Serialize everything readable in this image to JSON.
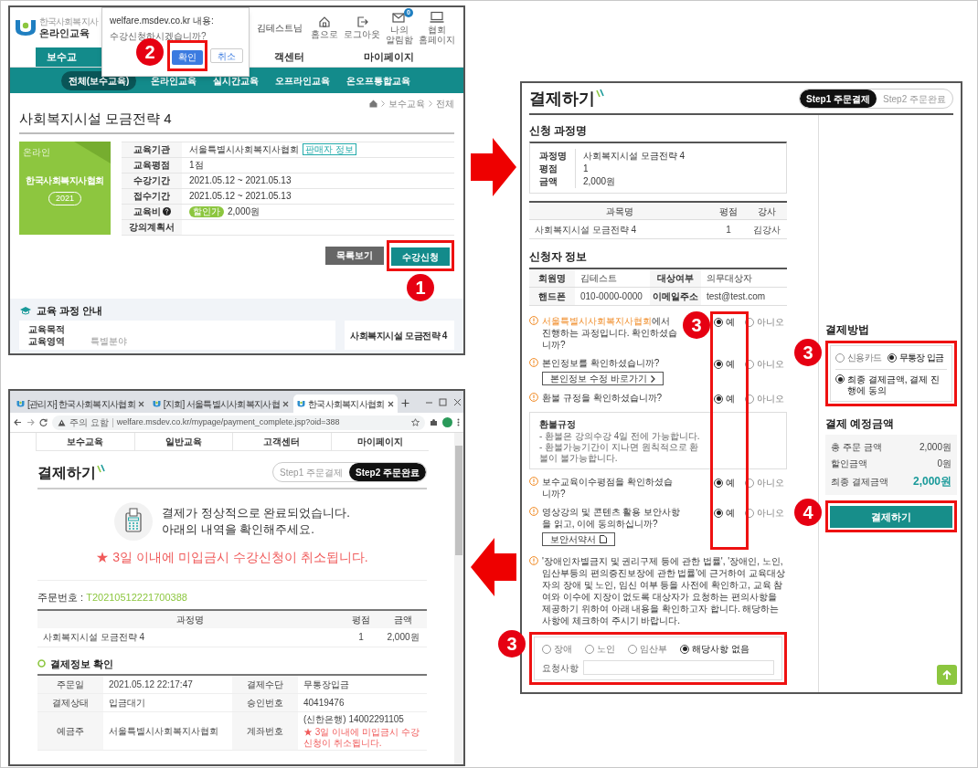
{
  "course_page": {
    "logo": {
      "subtitle": "한국사회복지사",
      "title": "온라인교육"
    },
    "user_name": "김테스트님",
    "header_links": [
      {
        "label": "홈으로",
        "kind": "home"
      },
      {
        "label": "로그아웃",
        "kind": "logout"
      },
      {
        "label": "나의 알림함",
        "kind": "alerts",
        "badge": "0"
      },
      {
        "label": "협회 홈페이지",
        "kind": "site"
      }
    ],
    "main_nav": [
      {
        "label": "보수교",
        "selected": true
      },
      {
        "label": "객센터",
        "selected": false
      },
      {
        "label": "마이페이지",
        "selected": false
      }
    ],
    "dialog": {
      "title": "welfare.msdev.co.kr 내용:",
      "message": "수강신청하시겠습니까?",
      "buttons": [
        {
          "label": "확인",
          "kind": "primary"
        },
        {
          "label": "취소",
          "kind": "secondary"
        }
      ]
    },
    "sub_nav": [
      {
        "label": "전체(보수교육)",
        "selected": true
      },
      {
        "label": "온라인교육",
        "selected": false
      },
      {
        "label": "실시간교육",
        "selected": false
      },
      {
        "label": "오프라인교육",
        "selected": false
      },
      {
        "label": "온오프통합교육",
        "selected": false
      }
    ],
    "breadcrumb": [
      "보수교육",
      "전체"
    ],
    "title": "사회복지시설 모금전략 4",
    "thumbnail": {
      "tag": "온라인",
      "title": "한국사회복지사협회",
      "year": "2021"
    },
    "info_rows": [
      {
        "label": "교육기관",
        "value": "서울특별시사회복지사협회",
        "kind": "seller",
        "badge": "판매자 정보"
      },
      {
        "label": "교육평점",
        "value": "1점",
        "kind": "plain"
      },
      {
        "label": "수강기간",
        "value": "2021.05.12 ~ 2021.05.13",
        "kind": "plain"
      },
      {
        "label": "접수기간",
        "value": "2021.05.12 ~ 2021.05.13",
        "kind": "plain"
      },
      {
        "label": "교육비",
        "value": "2,000원",
        "kind": "fee",
        "badge": "할인가"
      },
      {
        "label": "강의계획서",
        "kind": "plain"
      }
    ],
    "buttons": [
      {
        "label": "목록보기",
        "kind": "secondary"
      },
      {
        "label": "수강신청",
        "kind": "primary"
      }
    ],
    "guide": {
      "title": "교육 과정 안내",
      "rows": [
        {
          "label": "교육목적"
        },
        {
          "label": "교육영역",
          "value": "특별분야"
        }
      ],
      "side_title": "사회복지시설 모금전략 4"
    }
  },
  "payment_page": {
    "title": "결제하기",
    "steps": [
      {
        "label": "Step1 주문결제",
        "selected": true
      },
      {
        "label": "Step2 주문완료",
        "selected": false
      }
    ],
    "course_section": {
      "title": "신청 과정명",
      "summary": [
        {
          "label": "과정명",
          "value": "사회복지시설 모금전략 4"
        },
        {
          "label": "평점",
          "value": "1"
        },
        {
          "label": "금액",
          "value": "2,000원"
        }
      ],
      "columns": [
        "과목명",
        "평점",
        "강사"
      ],
      "rows": [
        [
          "사회복지시설 모금전략 4",
          "1",
          "김강사"
        ]
      ]
    },
    "applicant": {
      "title": "신청자 정보",
      "rows": [
        [
          "회원명",
          "김테스트",
          "대상여부",
          "의무대상자"
        ],
        [
          "핸드폰",
          "010-0000-0000",
          "이메일주소",
          "test@test.com"
        ]
      ]
    },
    "questions": [
      {
        "highlight": "서울특별시사회복지사협회",
        "text": "에서 진행하는 과정입니다. 확인하셨습니까?",
        "options": [
          {
            "label": "예",
            "selected": true
          },
          {
            "label": "아니오",
            "selected": false
          }
        ]
      },
      {
        "text": "본인정보를 확인하셨습니까?",
        "button": "본인정보 수정 바로가기",
        "options": [
          {
            "label": "예",
            "selected": true
          },
          {
            "label": "아니오",
            "selected": false
          }
        ]
      },
      {
        "text": "환불 규정을 확인하셨습니까?",
        "refund": {
          "title": "환불규정",
          "lines": [
            "- 환불은 강의수강 4일 전에 가능합니다.",
            "- 환불가능기간이 지나면 원칙적으로 환불이 불가능합니다."
          ]
        },
        "options": [
          {
            "label": "예",
            "selected": true
          },
          {
            "label": "아니오",
            "selected": false
          }
        ]
      },
      {
        "text": "보수교육이수평점을 확인하셨습니까?",
        "options": [
          {
            "label": "예",
            "selected": true
          },
          {
            "label": "아니오",
            "selected": false
          }
        ]
      },
      {
        "text": "영상강의 및 콘텐츠 활용 보안사항을 읽고, 이에 동의하십니까?",
        "button": "보안서약서",
        "options": [
          {
            "label": "예",
            "selected": true
          },
          {
            "label": "아니오",
            "selected": false
          }
        ]
      }
    ],
    "notice": "'장애인차별금지 및 권리구제 등에 관한 법률', '장애인, 노인, 임산부등의 편의증진보장에 관한 법률'에 근거하여 교육대상자의 장애 및 노인, 임신 여부 등을 사전에 확인하고, 교육 참여와 이수에 지장이 없도록 대상자가 요청하는 편의사항을 제공하기 위하여 아래 내용을 확인하고자 합니다. 해당하는 사항에 체크하여 주시기 바랍니다.",
    "accommodations": [
      {
        "label": "장애",
        "selected": false
      },
      {
        "label": "노인",
        "selected": false
      },
      {
        "label": "임산부",
        "selected": false
      },
      {
        "label": "해당사항 없음",
        "selected": true
      }
    ],
    "request_label": "요청사항",
    "payment_method": {
      "title": "결제방법",
      "options": [
        {
          "label": "신용카드",
          "selected": false
        },
        {
          "label": "무통장 입금",
          "selected": true
        }
      ],
      "agree": {
        "label": "최종 결제금액, 결제 진행에 동의",
        "checked": true
      }
    },
    "expected": {
      "title": "결제 예정금액",
      "rows": [
        {
          "label": "총 주문 금액",
          "value": "2,000원",
          "kind": "plain"
        },
        {
          "label": "할인금액",
          "value": "0원",
          "kind": "plain"
        },
        {
          "label": "최종 결제금액",
          "value": "2,000원",
          "kind": "total"
        }
      ]
    },
    "pay_button": "결제하기"
  },
  "complete_page": {
    "tabs": [
      {
        "title": "[관리자] 한국사회복지사협회",
        "selected": false
      },
      {
        "title": "[지회] 서울특별시사회복지사협",
        "selected": false
      },
      {
        "title": "한국사회복지사협회",
        "selected": true
      }
    ],
    "address": {
      "warning": "주의 요함",
      "url": "welfare.msdev.co.kr/mypage/payment_complete.jsp?oid=388"
    },
    "nav": [
      "보수교육",
      "일반교육",
      "고객센터",
      "마이페이지"
    ],
    "title": "결제하기",
    "steps": [
      {
        "label": "Step1 주문결제",
        "selected": false
      },
      {
        "label": "Step2 주문완료",
        "selected": true
      }
    ],
    "message": [
      "결제가 정상적으로 완료되었습니다.",
      "아래의 내역을 확인해주세요."
    ],
    "warning": "★ 3일 이내에 미입금시 수강신청이 취소됩니다.",
    "order_label": "주문번호 : ",
    "order_number": "T20210512221700388",
    "columns": [
      "과정명",
      "평점",
      "금액"
    ],
    "rows": [
      [
        "사회복지시설 모금전략 4",
        "1",
        "2,000원"
      ]
    ],
    "pay_info": {
      "title": "결제정보 확인",
      "rows": [
        [
          "주문일",
          "2021.05.12 22:17:47",
          "결제수단",
          "무통장입금"
        ],
        [
          "결제상태",
          "입금대기",
          "승인번호",
          "40419476"
        ],
        [
          "예금주",
          "서울특별시사회복지사협회",
          "계좌번호",
          "(신한은행) 14002291105"
        ]
      ],
      "note": "★ 3일 이내에 미입금시 수강신청이 취소됩니다."
    }
  },
  "callouts": [
    {
      "number": "2"
    },
    {
      "number": "1"
    },
    {
      "number": "3"
    },
    {
      "number": "3"
    },
    {
      "number": "4"
    },
    {
      "number": "3"
    }
  ]
}
